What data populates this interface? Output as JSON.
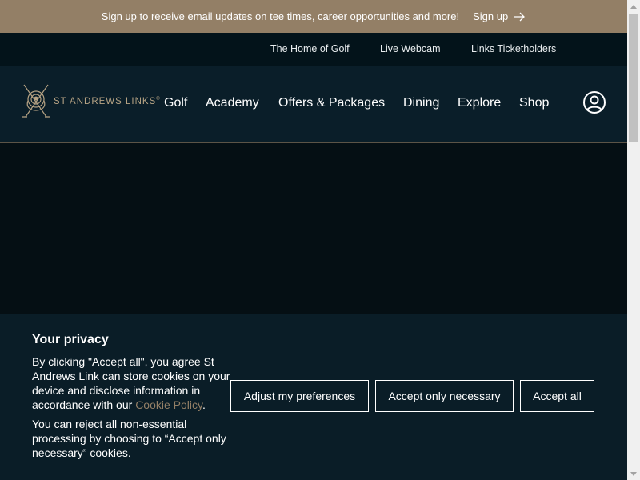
{
  "promo": {
    "text": "Sign up to receive email updates on tee times, career opportunities and more!",
    "signup_label": "Sign up",
    "signup_icon": "arrow-right-icon"
  },
  "utility_nav": {
    "items": [
      "The Home of Golf",
      "Live Webcam",
      "Links Ticketholders"
    ]
  },
  "header": {
    "logo_text": "ST ANDREWS LINKS",
    "logo_mark": "®",
    "nav": [
      "Golf",
      "Academy",
      "Offers & Packages",
      "Dining",
      "Explore",
      "Shop"
    ],
    "account_icon": "user-circle-icon"
  },
  "cookie_banner": {
    "title": "Your privacy",
    "body_before_link": "By clicking \"Accept all\", you agree St Andrews Link can store cookies on your device and disclose information in accordance with our ",
    "link_text": "Cookie Policy",
    "body_after_link": ".",
    "body2": "You can reject all non-essential processing by choosing to “Accept only necessary” cookies.",
    "buttons": {
      "adjust": "Adjust my preferences",
      "necessary": "Accept only necessary",
      "accept_all": "Accept all"
    }
  },
  "colors": {
    "promo_bg": "#937f66",
    "utility_bg": "#03131a",
    "nav_bg": "#0a1e29",
    "page_bg": "#050f14",
    "banner_bg": "#0a1d27",
    "gold": "#b6a384"
  }
}
